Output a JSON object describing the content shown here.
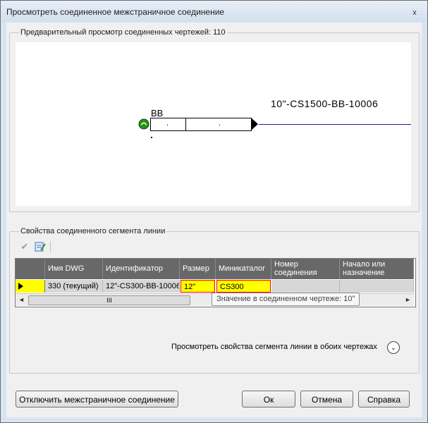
{
  "window": {
    "title": "Просмотреть соединенное межстраничное соединение",
    "close_glyph": "x"
  },
  "preview": {
    "group_label": "Предварительный просмотр соединенных чертежей: 110",
    "line_label": "10\"-CS1500-BB-10006",
    "connector_label": "BB",
    "cell_mark_1": ".",
    "cell_mark_2": "."
  },
  "properties": {
    "group_label": "Свойства соединенного сегмента линии",
    "toolbar": {
      "accept_icon": "checkmark-icon",
      "edit_icon": "edit-table-icon"
    },
    "columns": [
      "Имя DWG",
      "Идентификатор",
      "Размер",
      "Миникаталог",
      "Номер соединения",
      "Начало или назначение"
    ],
    "row": {
      "dwg_name": "330  (текущий)",
      "identifier": "12\"-CS300-BB-10006",
      "size": "12\"",
      "minicatalog": "CS300",
      "connection_number": "",
      "start_or_destination": ""
    },
    "scroll_left": "◄",
    "scroll_right": "►",
    "scroll_thumb": "III",
    "tooltip": "Значение в соединенном чертеже: 10\"",
    "view_both_label": "Просмотреть свойства сегмента линии в обоих чертежах",
    "expand_glyph": "⌄"
  },
  "buttons": {
    "disconnect": "Отключить межстраничное соединение",
    "ok": "Ок",
    "cancel": "Отмена",
    "help": "Справка"
  },
  "colors": {
    "highlight": "#ffff00",
    "highlight_border": "#ff0000",
    "line": "#1a1aaa",
    "header_bg": "#686868"
  }
}
